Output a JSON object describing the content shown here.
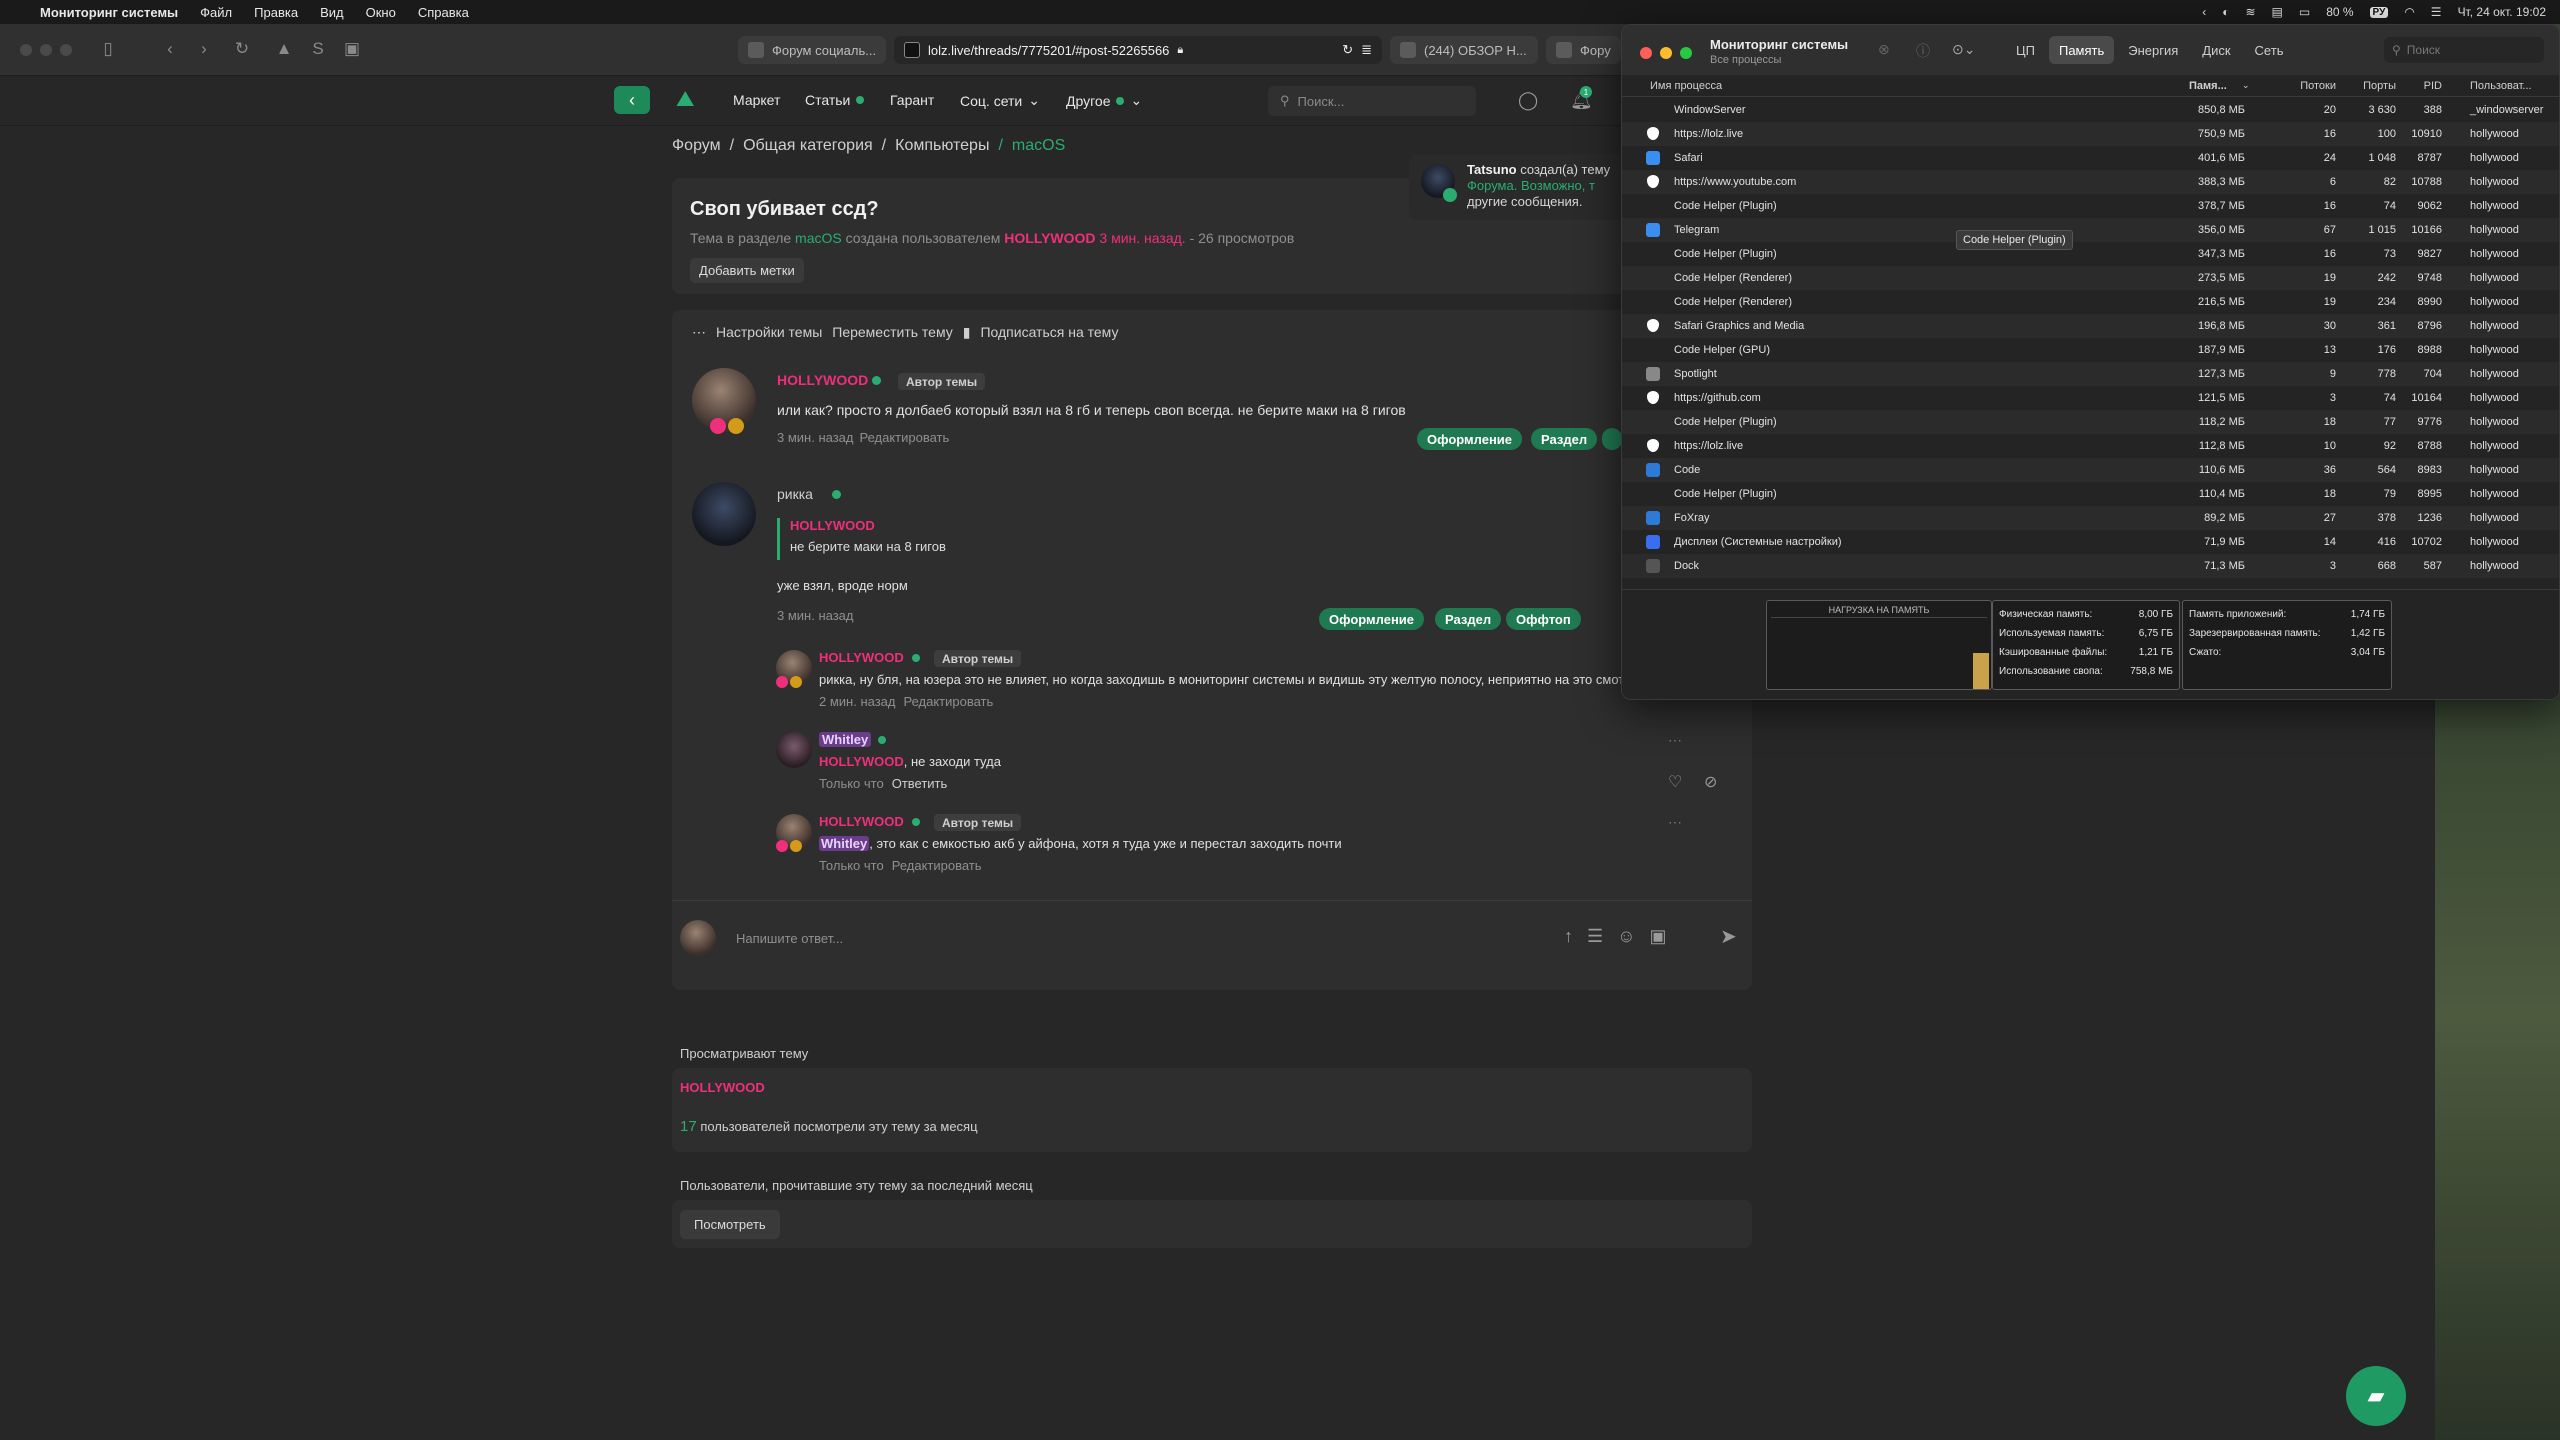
{
  "menubar": {
    "app": "Мониторинг системы",
    "items": [
      "Файл",
      "Правка",
      "Вид",
      "Окно",
      "Справка"
    ],
    "battery": "80 %",
    "lang": "РУ",
    "datetime": "Чт, 24 окт.  19:02"
  },
  "browser": {
    "tabs": [
      {
        "label": "Форум социаль..."
      },
      {
        "label": "lolz.live/threads/7775201/#post-52265566"
      },
      {
        "label": "(244) ОБЗОР Н..."
      },
      {
        "label": "Фору"
      }
    ],
    "nav": {
      "market": "Маркет",
      "articles": "Статьи",
      "guarantor": "Гарант",
      "social": "Соц. сети",
      "other": "Другое",
      "search_placeholder": "Поиск..."
    },
    "notif_count": "1"
  },
  "thread": {
    "breadcrumbs": [
      "Форум",
      "Общая категория",
      "Компьютеры",
      "macOS"
    ],
    "title": "Своп убивает ссд?",
    "meta_prefix": "Тема в разделе",
    "meta_section": "macOS",
    "meta_mid": "создана пользователем",
    "meta_author": "HOLLYWOOD",
    "meta_time": "3 мин. назад.",
    "meta_views": "- 26 просмотров",
    "add_tags": "Добавить метки",
    "actions": [
      "Настройки темы",
      "Переместить тему",
      "Подписаться на тему"
    ],
    "notice": {
      "user": "Tatsuno",
      "text1": "создал(а) тему",
      "text2": "Форума. Возможно, т",
      "text3": "другие сообщения."
    }
  },
  "posts": [
    {
      "author": "HOLLYWOOD",
      "badge": "Автор темы",
      "text": "или как? просто я долбаеб который взял на 8 гб и теперь своп всегда. не берите маки на 8 гигов",
      "time": "3 мин. назад",
      "edit": "Редактировать",
      "tags": [
        "Оформление",
        "Раздел"
      ]
    },
    {
      "author": "рикка",
      "quote_author": "HOLLYWOOD",
      "quote_text": "не берите маки на 8 гигов",
      "text": "уже взял, вроде норм",
      "time": "3 мин. назад",
      "tags": [
        "Оформление",
        "Раздел",
        "Оффтоп"
      ]
    }
  ],
  "comments": [
    {
      "author": "HOLLYWOOD",
      "badge": "Автор темы",
      "text": "рикка, ну бля, на юзера это не влияет, но когда заходишь в мониторинг системы и видишь эту желтую полосу, неприятно на это смотреть",
      "time": "2 мин. назад",
      "action": "Редактировать"
    },
    {
      "author": "Whitley",
      "mention": "HOLLYWOOD",
      "text": ", не заходи туда",
      "time": "Только что",
      "action": "Ответить"
    },
    {
      "author": "HOLLYWOOD",
      "badge": "Автор темы",
      "mention": "Whitley",
      "text": ", это как с емкостью акб у айфона, хотя я туда уже и перестал заходить почти",
      "time": "Только что",
      "action": "Редактировать"
    }
  ],
  "reply": {
    "placeholder": "Напишите ответ..."
  },
  "viewers": {
    "label": "Просматривают тему",
    "user": "HOLLYWOOD",
    "count": "17",
    "count_text": "пользователей посмотрели эту тему за месяц",
    "readers_label": "Пользователи, прочитавшие эту тему за последний месяц",
    "view_button": "Посмотреть"
  },
  "monitor": {
    "title": "Мониторинг системы",
    "subtitle": "Все процессы",
    "tabs": [
      "ЦП",
      "Память",
      "Энергия",
      "Диск",
      "Сеть"
    ],
    "active_tab": "Память",
    "search_placeholder": "Поиск",
    "columns": [
      "Имя процесса",
      "Памя...",
      "Потоки",
      "Порты",
      "PID",
      "Пользоват..."
    ],
    "rows": [
      [
        "WindowServer",
        "850,8 МБ",
        "20",
        "3 630",
        "388",
        "_windowserver"
      ],
      [
        "https://lolz.live",
        "750,9 МБ",
        "16",
        "100",
        "10910",
        "hollywood"
      ],
      [
        "Safari",
        "401,6 МБ",
        "24",
        "1 048",
        "8787",
        "hollywood"
      ],
      [
        "https://www.youtube.com",
        "388,3 МБ",
        "6",
        "82",
        "10788",
        "hollywood"
      ],
      [
        "Code Helper (Plugin)",
        "378,7 МБ",
        "16",
        "74",
        "9062",
        "hollywood"
      ],
      [
        "Telegram",
        "356,0 МБ",
        "67",
        "1 015",
        "10166",
        "hollywood"
      ],
      [
        "Code Helper (Plugin)",
        "347,3 МБ",
        "16",
        "73",
        "9827",
        "hollywood"
      ],
      [
        "Code Helper (Renderer)",
        "273,5 МБ",
        "19",
        "242",
        "9748",
        "hollywood"
      ],
      [
        "Code Helper (Renderer)",
        "216,5 МБ",
        "19",
        "234",
        "8990",
        "hollywood"
      ],
      [
        "Safari Graphics and Media",
        "196,8 МБ",
        "30",
        "361",
        "8796",
        "hollywood"
      ],
      [
        "Code Helper (GPU)",
        "187,9 МБ",
        "13",
        "176",
        "8988",
        "hollywood"
      ],
      [
        "Spotlight",
        "127,3 МБ",
        "9",
        "778",
        "704",
        "hollywood"
      ],
      [
        "https://github.com",
        "121,5 МБ",
        "3",
        "74",
        "10164",
        "hollywood"
      ],
      [
        "Code Helper (Plugin)",
        "118,2 МБ",
        "18",
        "77",
        "9776",
        "hollywood"
      ],
      [
        "https://lolz.live",
        "112,8 МБ",
        "10",
        "92",
        "8788",
        "hollywood"
      ],
      [
        "Code",
        "110,6 МБ",
        "36",
        "564",
        "8983",
        "hollywood"
      ],
      [
        "Code Helper (Plugin)",
        "110,4 МБ",
        "18",
        "79",
        "8995",
        "hollywood"
      ],
      [
        "FoXray",
        "89,2 МБ",
        "27",
        "378",
        "1236",
        "hollywood"
      ],
      [
        "Дисплеи (Системные настройки)",
        "71,9 МБ",
        "14",
        "416",
        "10702",
        "hollywood"
      ],
      [
        "Dock",
        "71,3 МБ",
        "3",
        "668",
        "587",
        "hollywood"
      ]
    ],
    "tooltip": "Code Helper (Plugin)",
    "pressure_label": "НАГРУЗКА НА ПАМЯТЬ",
    "stats_left": [
      [
        "Физическая память:",
        "8,00 ГБ"
      ],
      [
        "Используемая память:",
        "6,75 ГБ"
      ],
      [
        "Кэшированные файлы:",
        "1,21 ГБ"
      ],
      [
        "Использование свопа:",
        "758,8 МБ"
      ]
    ],
    "stats_right": [
      [
        "Память приложений:",
        "1,74 ГБ"
      ],
      [
        "Зарезервированная память:",
        "1,42 ГБ"
      ],
      [
        "Сжато:",
        "3,04 ГБ"
      ]
    ]
  }
}
